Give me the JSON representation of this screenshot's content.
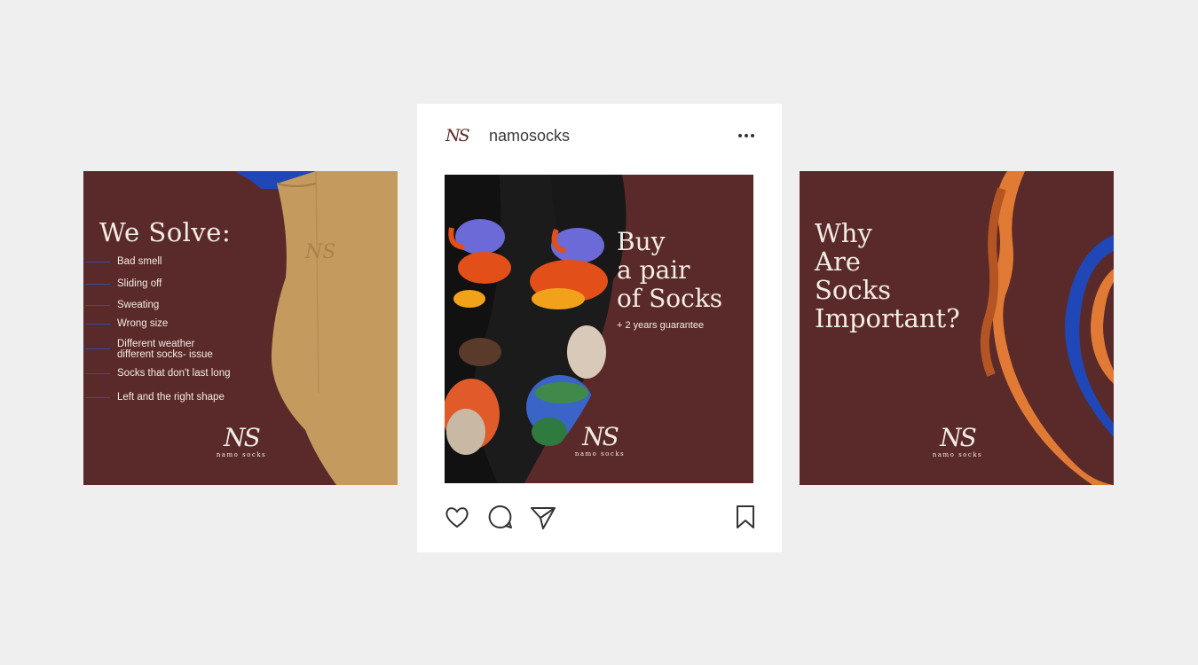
{
  "left_tile": {
    "title": "We Solve:",
    "issues": [
      "Bad smell",
      "Sliding off",
      "Sweating",
      "Wrong size",
      "Different weather\ndifferent socks- issue",
      "Socks that don't last long",
      "Left and the right shape"
    ],
    "brand_monogram": "NS",
    "brand_name": "namo socks"
  },
  "ig_card": {
    "avatar_monogram": "NS",
    "username": "namosocks",
    "post": {
      "title_lines": "Buy\na pair\nof Socks",
      "subtitle": "+ 2 years guarantee",
      "brand_monogram": "NS",
      "brand_name": "namo socks"
    },
    "icons": [
      "heart-icon",
      "comment-icon",
      "share-icon",
      "bookmark-icon",
      "more-icon"
    ]
  },
  "right_tile": {
    "title_lines": "Why\nAre\nSocks\nImportant?",
    "brand_monogram": "NS",
    "brand_name": "namo socks"
  },
  "colors": {
    "background": "#efefef",
    "maroon": "#5a2a2a",
    "tan": "#c49a5e",
    "royal_blue": "#1f47b8",
    "orange": "#e07a34",
    "cream_text": "#f3ece4"
  }
}
